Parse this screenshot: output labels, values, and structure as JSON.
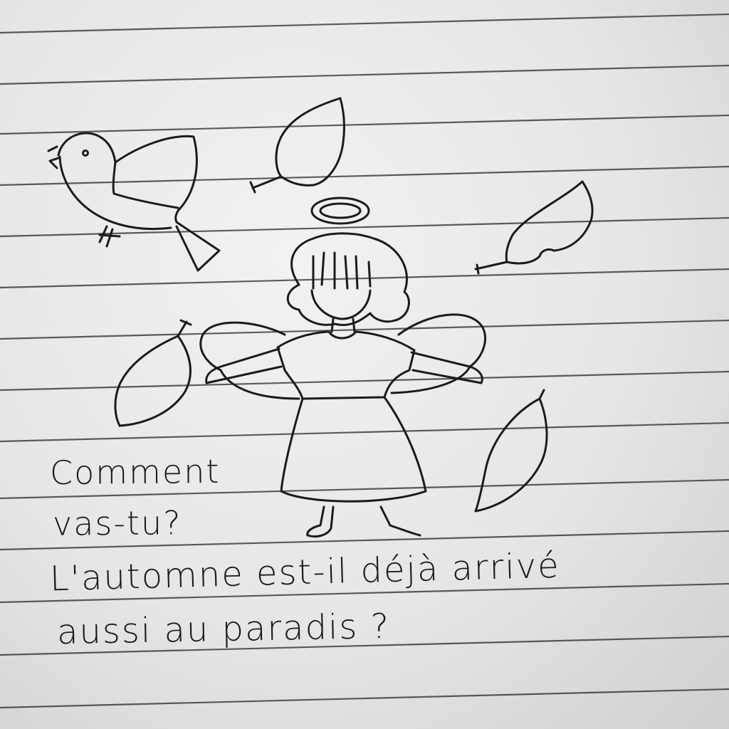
{
  "note": {
    "lines": [
      "Comment",
      "vas-tu?",
      "L'automne est-il déjà arrivé",
      "aussi au paradis ?"
    ]
  },
  "drawing": {
    "subjects": [
      "bird-icon",
      "angel-icon",
      "halo-icon",
      "leaf-icon"
    ],
    "ink_color": "#1b1b1b",
    "rule_color": "#2a2a2a",
    "paper_color": "#e9e9e9"
  }
}
